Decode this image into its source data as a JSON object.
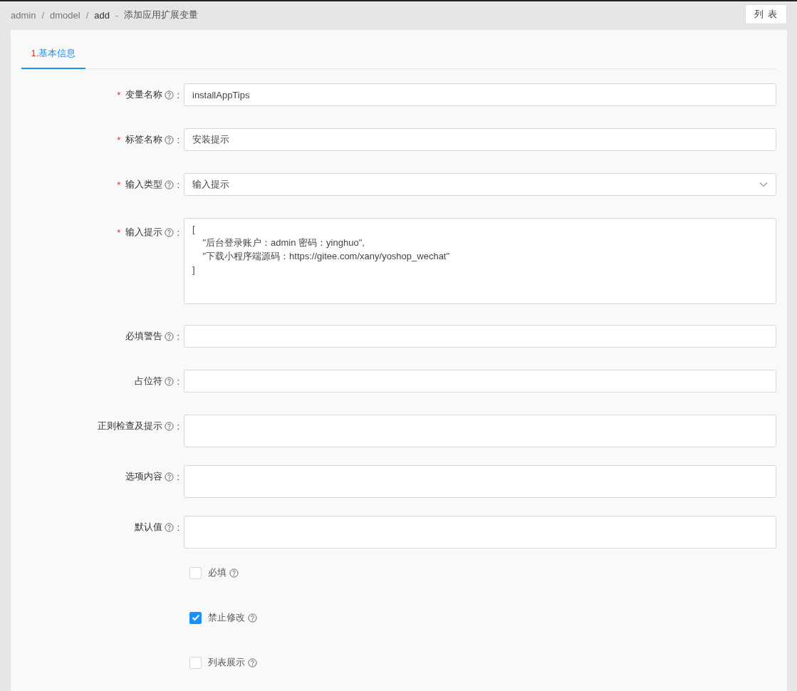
{
  "breadcrumb": {
    "items": [
      "admin",
      "dmodel",
      "add"
    ],
    "separator": "/",
    "dash": "-",
    "title": "添加应用扩展变量"
  },
  "list_button": "列 表",
  "tabs": [
    {
      "number": "1.",
      "label": "基本信息",
      "selected": true
    }
  ],
  "fields": [
    {
      "kind": "input",
      "label": "变量名称",
      "required": true,
      "value": "installAppTips"
    },
    {
      "kind": "input",
      "label": "标签名称",
      "required": true,
      "value": "安装提示"
    },
    {
      "kind": "select",
      "label": "输入类型",
      "required": true,
      "value": "输入提示"
    },
    {
      "kind": "textarea",
      "label": "输入提示",
      "required": true,
      "value": "[\n\t\"后台登录账户：admin 密码：yinghuo\",\n\t\"下载小程序端源码：https://gitee.com/xany/yoshop_wechat\"\n]"
    },
    {
      "kind": "input",
      "label": "必填警告",
      "required": false
    },
    {
      "kind": "input",
      "label": "占位符",
      "required": false
    },
    {
      "kind": "textarea-small",
      "label": "正则检查及提示",
      "required": false
    },
    {
      "kind": "textarea-small",
      "label": "选项内容",
      "required": false
    },
    {
      "kind": "textarea-small",
      "label": "默认值",
      "required": false
    }
  ],
  "required_mark": "*",
  "colon": ":",
  "checkboxes": [
    {
      "label": "必填",
      "checked": false
    },
    {
      "label": "禁止修改",
      "checked": true
    },
    {
      "label": "列表展示",
      "checked": false
    }
  ]
}
